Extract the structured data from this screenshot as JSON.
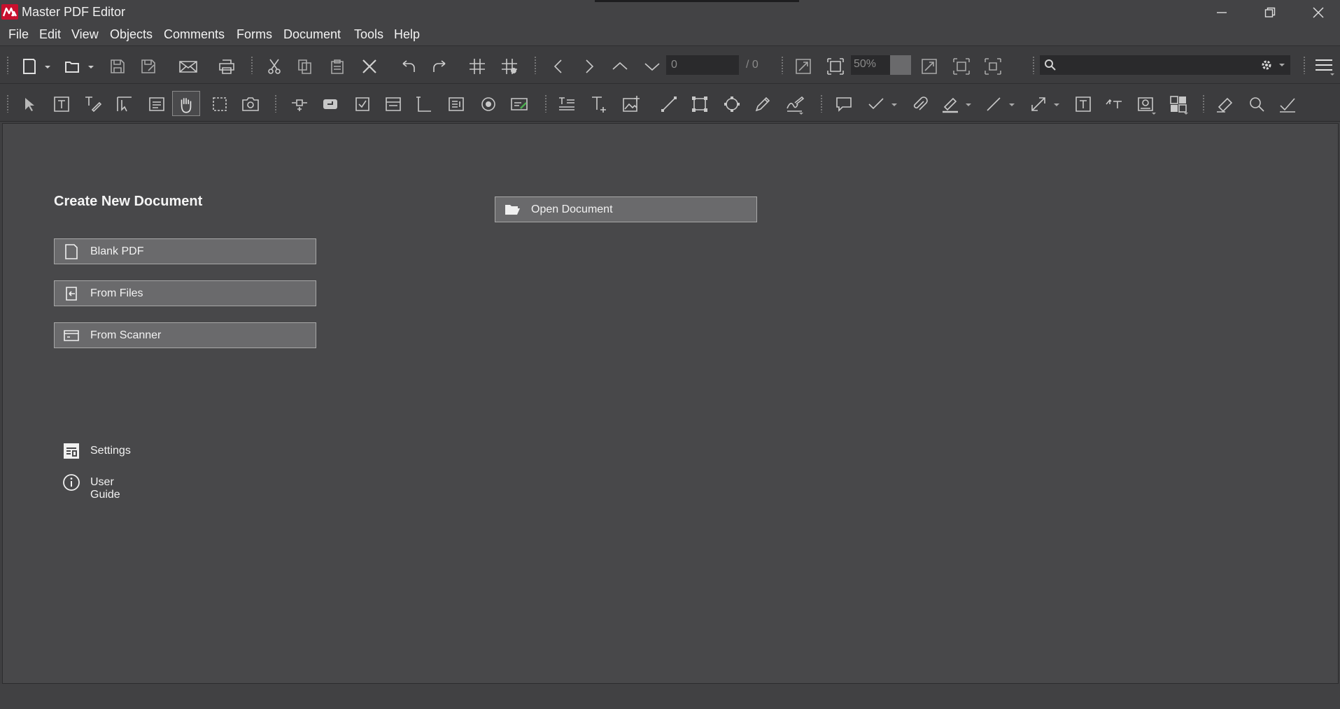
{
  "window": {
    "title": "Master PDF Editor",
    "colors": {
      "logo": "#c8102e",
      "background": "#48484a",
      "button": "#6a6a6c"
    }
  },
  "menu": [
    "File",
    "Edit",
    "View",
    "Objects",
    "Comments",
    "Forms",
    "Document",
    "Tools",
    "Help"
  ],
  "toolbar": {
    "page_number": "0",
    "page_total": "/ 0",
    "zoom": "50%",
    "search_placeholder": ""
  },
  "start_page": {
    "create_title": "Create New Document",
    "blank_pdf": "Blank PDF",
    "from_files": "From Files",
    "from_scanner": "From Scanner",
    "open_document": "Open Document",
    "settings": "Settings",
    "user_guide": "User Guide"
  }
}
